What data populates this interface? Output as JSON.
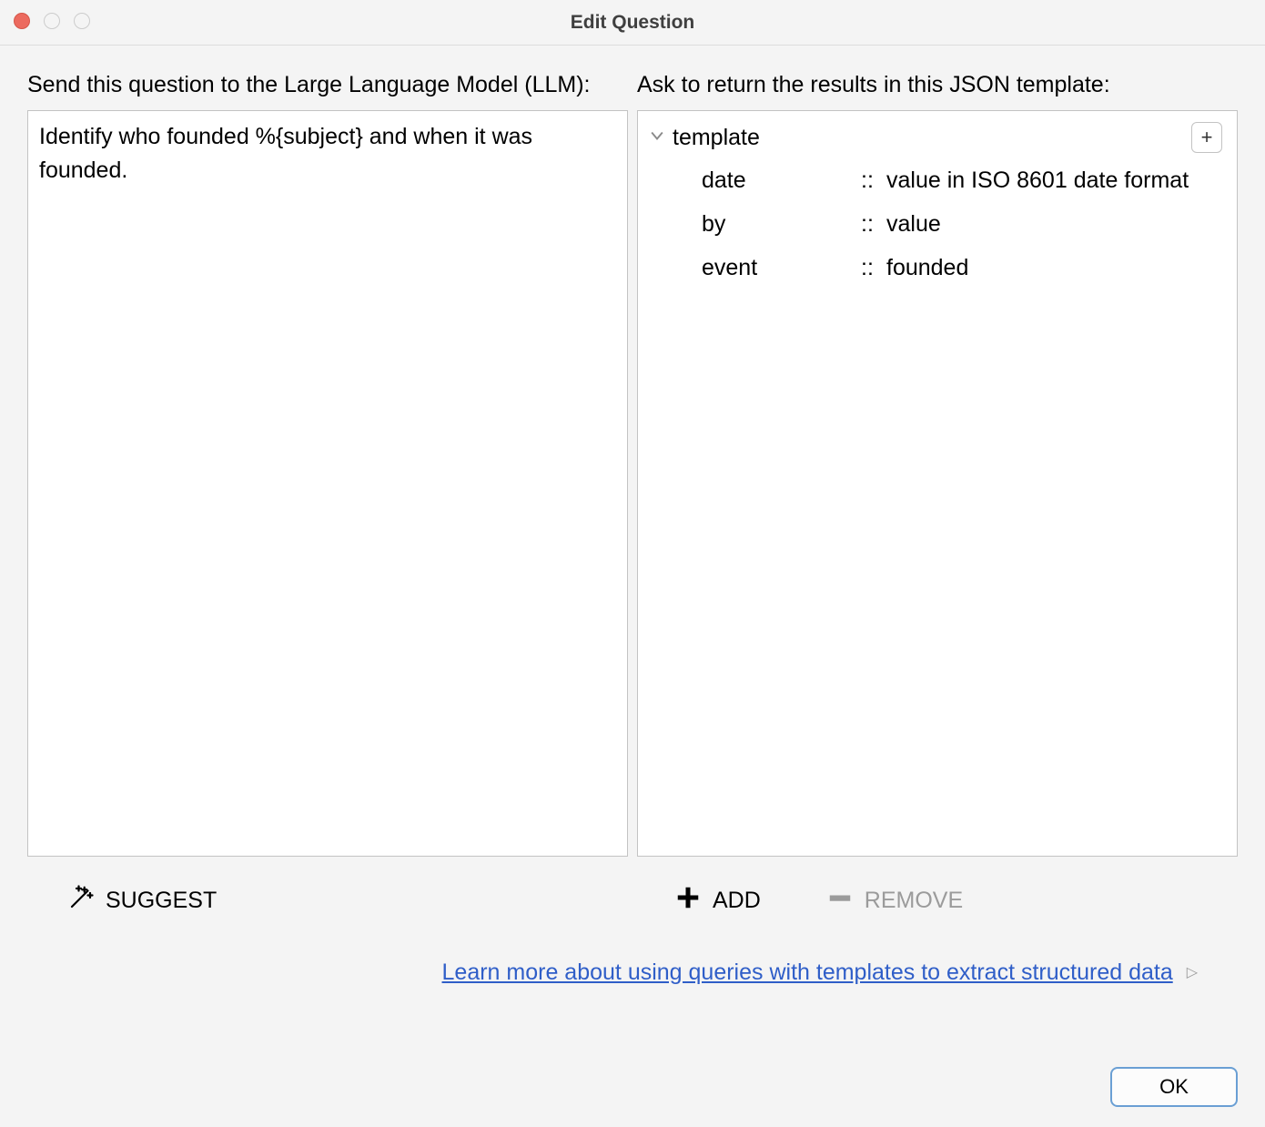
{
  "window": {
    "title": "Edit Question"
  },
  "left": {
    "label": "Send this question to the Large Language Model (LLM):",
    "question": "Identify who founded %{subject} and when it was founded."
  },
  "right": {
    "label": "Ask to return the results in this JSON template:",
    "root": "template",
    "add_glyph": "+",
    "separator": "::",
    "rows": [
      {
        "key": "date",
        "value": "value in ISO 8601 date format"
      },
      {
        "key": "by",
        "value": "value"
      },
      {
        "key": "event",
        "value": "founded"
      }
    ]
  },
  "actions": {
    "suggest": "SUGGEST",
    "add": "ADD",
    "remove": "REMOVE"
  },
  "learn_more": {
    "text": "Learn more about using queries with templates to extract structured data"
  },
  "footer": {
    "ok": "OK"
  }
}
